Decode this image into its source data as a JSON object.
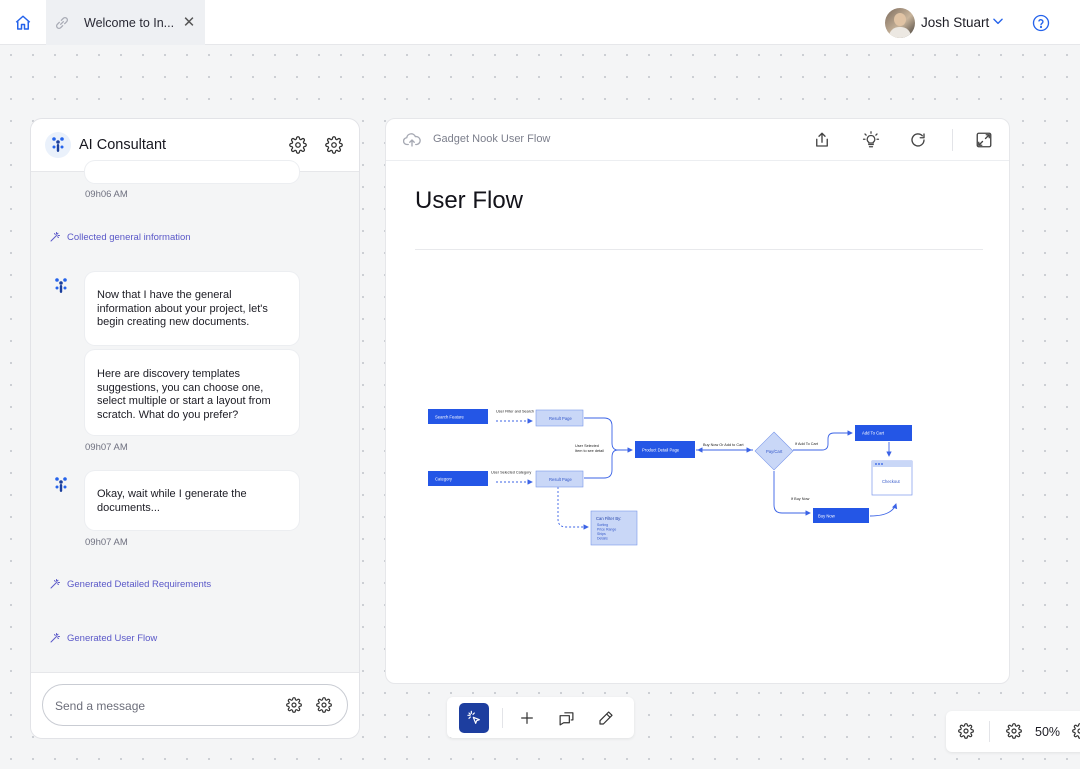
{
  "topbar": {
    "tab_label": "Welcome to In...",
    "user_name": "Josh Stuart"
  },
  "chat": {
    "title": "AI Consultant",
    "timestamps": [
      "09h06 AM",
      "09h07 AM",
      "09h07 AM"
    ],
    "statuses": [
      "Collected general information",
      "Generated Detailed Requirements",
      "Generated User Flow"
    ],
    "messages": [
      "Now that I have the general information about your project, let's begin creating new documents.",
      "Here are discovery templates suggestions, you can choose one, select multiple or start a layout from scratch. What do you prefer?",
      "Okay, wait while I generate the documents..."
    ],
    "input_placeholder": "Send a message"
  },
  "document": {
    "name": "Gadget Nook User Flow",
    "title": "User Flow"
  },
  "flow": {
    "nodes": {
      "search_feature": "Search Feature",
      "category": "Category",
      "result_page_1": "Result Page",
      "result_page_2": "Result Page",
      "product_detail": "Product Detail Page",
      "pay_cart": "Pay/Cart",
      "add_to_cart": "Add To Cart",
      "checkout": "Checkout",
      "buy_now": "Buy Now",
      "can_filter": "Can Filter By:",
      "filter_options": [
        "Sorting",
        "Price Range",
        "Ships",
        "Details"
      ]
    },
    "edges": {
      "user_filter": "User Filter and Search",
      "user_category": "User Selected Category",
      "user_selected": "User Selected",
      "item_detail": "Item to see detail",
      "buy_or_add": "Buy Now Or Add to Cart",
      "if_add": "If Add To Cart",
      "if_buy": "If Buy Now"
    }
  },
  "zoom": {
    "level": "50%"
  },
  "colors": {
    "accent": "#2563eb",
    "node_blue": "#2456e6",
    "node_light": "#c9d7f7",
    "status_purple": "#5a58c8",
    "tool_active": "#1d3e9f"
  }
}
